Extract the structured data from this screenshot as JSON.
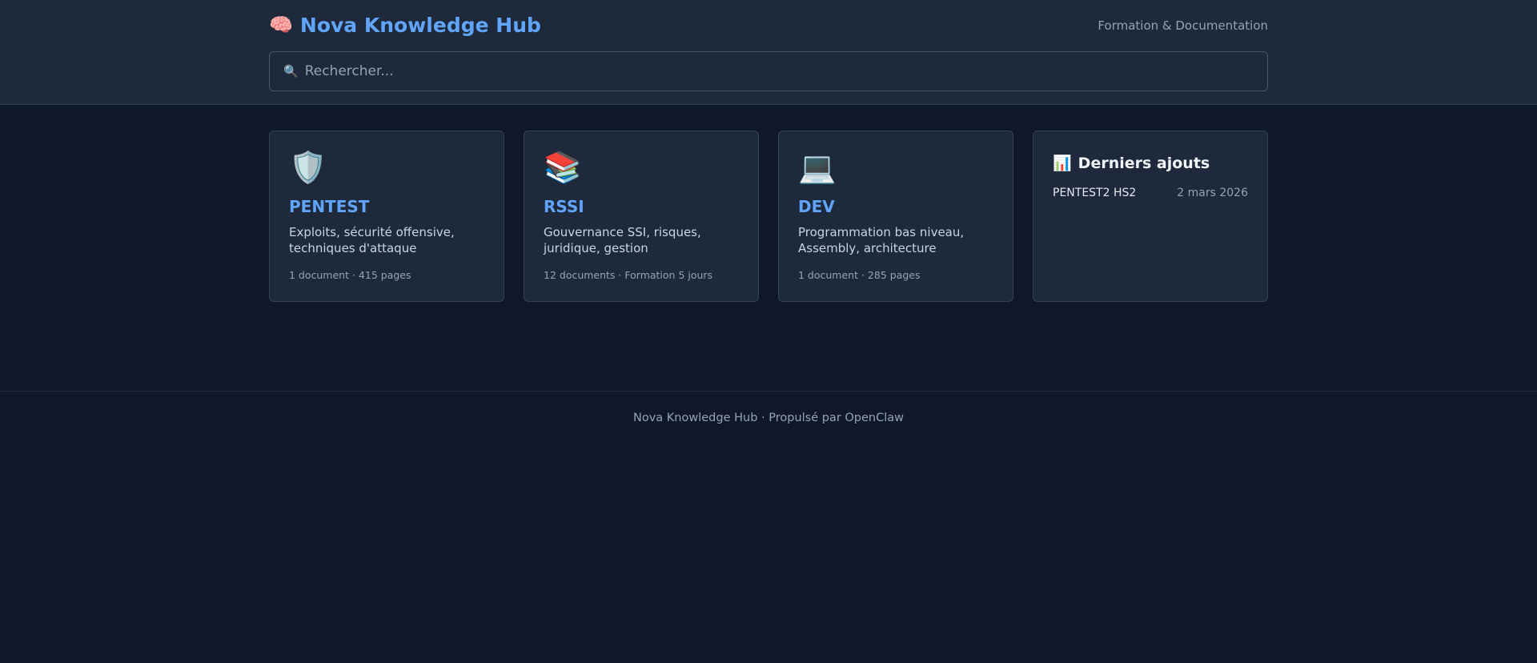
{
  "header": {
    "brand_icon": "🧠",
    "title": "Nova Knowledge Hub",
    "tagline": "Formation & Documentation"
  },
  "search": {
    "icon": "🔍",
    "placeholder": "Rechercher..."
  },
  "cards": [
    {
      "icon": "🛡️",
      "icon_name": "shield-icon",
      "title": "PENTEST",
      "description": "Exploits, sécurité offensive, techniques d'attaque",
      "meta": "1 document · 415 pages"
    },
    {
      "icon": "📚",
      "icon_name": "books-icon",
      "title": "RSSI",
      "description": "Gouvernance SSI, risques, juridique, gestion",
      "meta": "12 documents · Formation 5 jours"
    },
    {
      "icon": "💻",
      "icon_name": "laptop-icon",
      "title": "DEV",
      "description": "Programmation bas niveau, Assembly, architecture",
      "meta": "1 document · 285 pages"
    }
  ],
  "recent": {
    "icon": "📊",
    "title": "Derniers ajouts",
    "items": [
      {
        "name": "PENTEST2 HS2",
        "date": "2 mars 2026"
      }
    ]
  },
  "footer": {
    "text": "Nova Knowledge Hub · Propulsé par OpenClaw"
  },
  "colors": {
    "background": "#0f172a",
    "panel": "#1e293b",
    "accent": "#60a5fa",
    "border": "#334155"
  }
}
